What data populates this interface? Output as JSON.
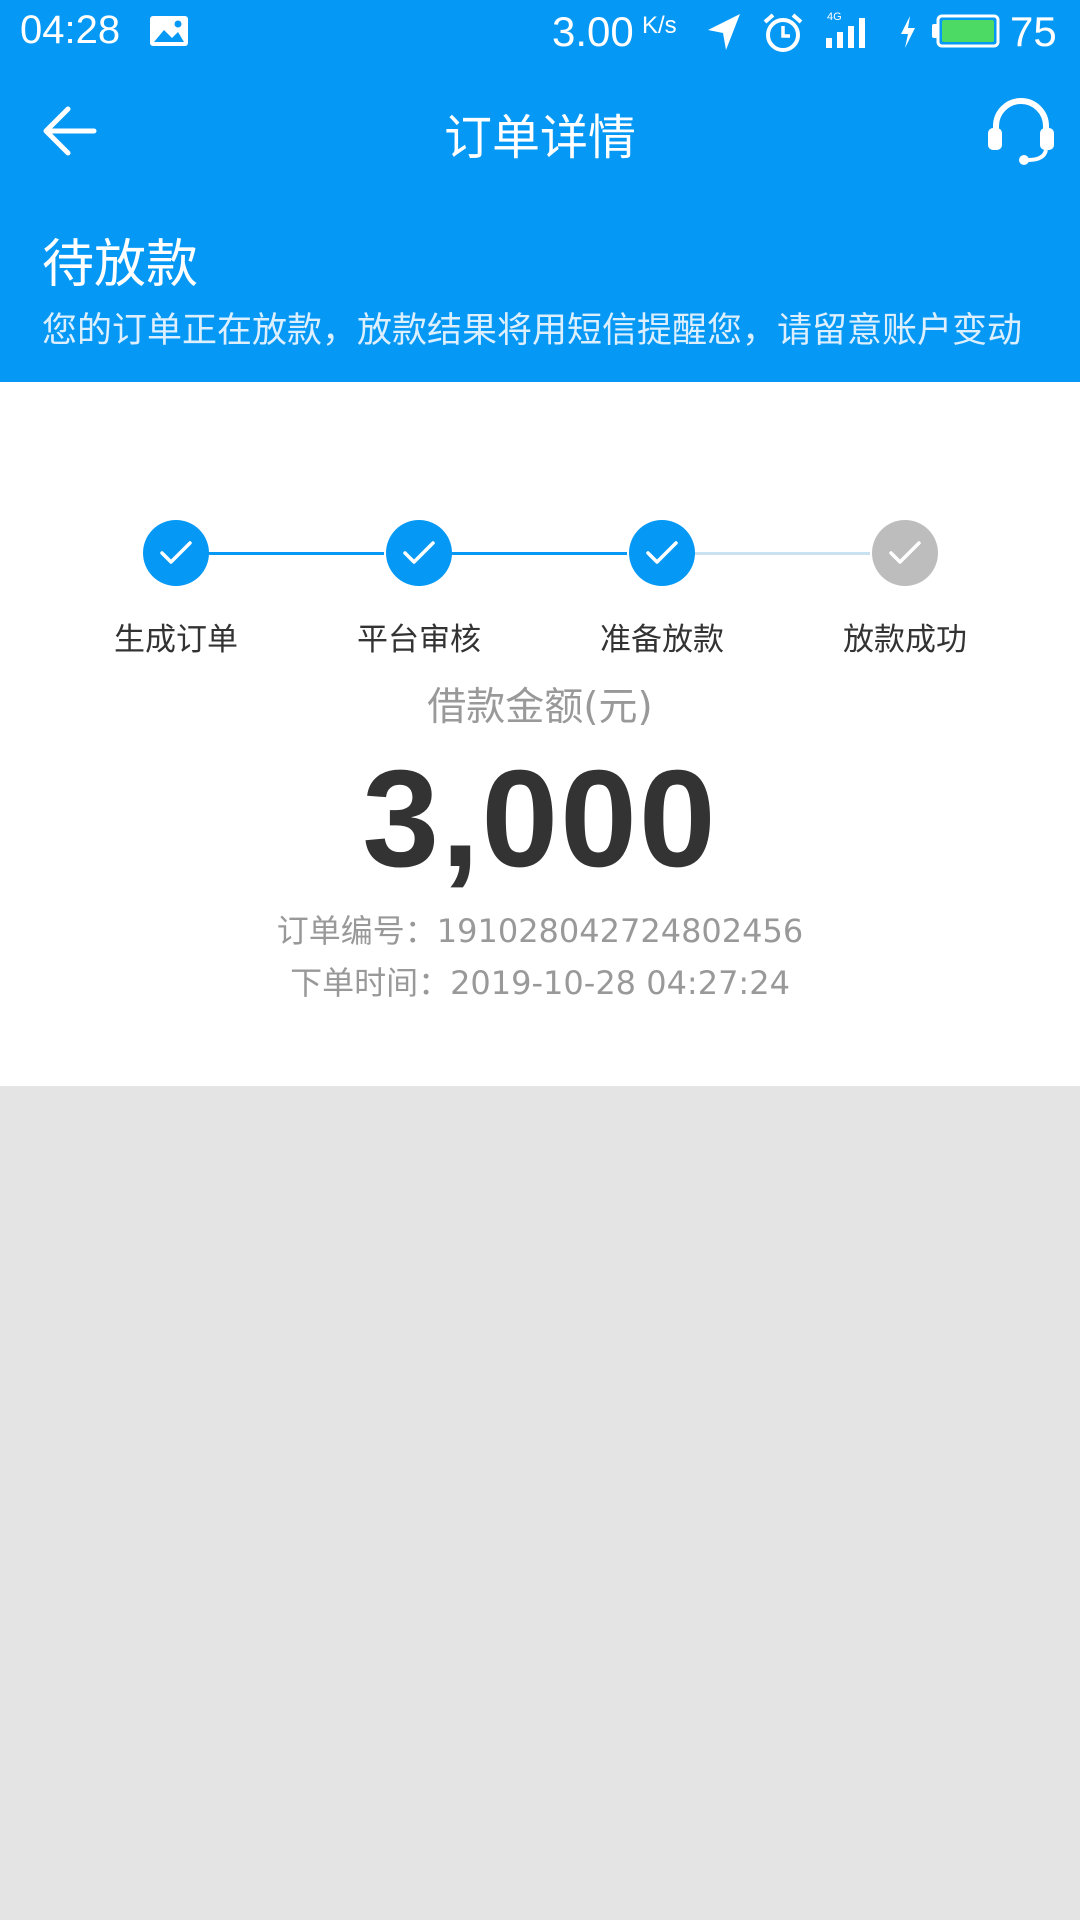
{
  "status_bar": {
    "time": "04:28",
    "net_speed": "3.00",
    "net_unit": "K/s",
    "network_type": "4G",
    "battery_level": "75",
    "icons": [
      "image-icon",
      "location-arrow-icon",
      "alarm-icon",
      "signal-icon",
      "charging-icon",
      "battery-icon"
    ]
  },
  "header": {
    "title": "订单详情",
    "back_icon": "arrow-left-icon",
    "service_icon": "headset-icon"
  },
  "status": {
    "title": "待放款",
    "description": "您的订单正在放款，放款结果将用短信提醒您，请留意账户变动"
  },
  "steps": [
    {
      "label": "生成订单",
      "done": true
    },
    {
      "label": "平台审核",
      "done": true
    },
    {
      "label": "准备放款",
      "done": true
    },
    {
      "label": "放款成功",
      "done": false
    }
  ],
  "loan": {
    "amount_label": "借款金额(元)",
    "amount": "3,000",
    "order_no": "订单编号：191028042724802456",
    "order_time": "下单时间：2019-10-28 04:27:24"
  },
  "colors": {
    "primary": "#0598f5",
    "step_done": "#0598f5",
    "step_pending": "#bdbdbd",
    "line_pending": "#c9e2f2",
    "page_bg": "#e4e4e4"
  }
}
